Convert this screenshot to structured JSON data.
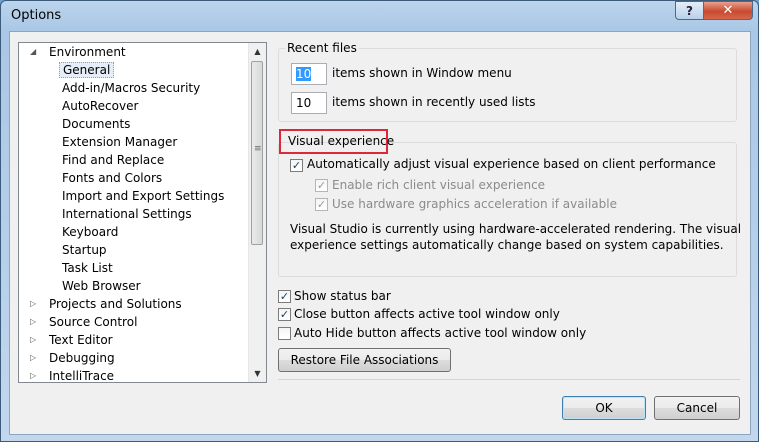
{
  "window": {
    "title": "Options",
    "help_label": "?",
    "close_label": "✕"
  },
  "tree": {
    "items": [
      {
        "label": "Environment",
        "expanded": true,
        "level": 0
      },
      {
        "label": "General",
        "level": 1,
        "selected": true
      },
      {
        "label": "Add-in/Macros Security",
        "level": 1
      },
      {
        "label": "AutoRecover",
        "level": 1
      },
      {
        "label": "Documents",
        "level": 1
      },
      {
        "label": "Extension Manager",
        "level": 1
      },
      {
        "label": "Find and Replace",
        "level": 1
      },
      {
        "label": "Fonts and Colors",
        "level": 1
      },
      {
        "label": "Import and Export Settings",
        "level": 1
      },
      {
        "label": "International Settings",
        "level": 1
      },
      {
        "label": "Keyboard",
        "level": 1
      },
      {
        "label": "Startup",
        "level": 1
      },
      {
        "label": "Task List",
        "level": 1
      },
      {
        "label": "Web Browser",
        "level": 1
      },
      {
        "label": "Projects and Solutions",
        "level": 0
      },
      {
        "label": "Source Control",
        "level": 0
      },
      {
        "label": "Text Editor",
        "level": 0
      },
      {
        "label": "Debugging",
        "level": 0
      },
      {
        "label": "IntelliTrace",
        "level": 0
      }
    ]
  },
  "recent_files": {
    "title": "Recent files",
    "window_menu_count": "10",
    "window_menu_label": "items shown in Window menu",
    "recent_lists_count": "10",
    "recent_lists_label": "items shown in recently used lists"
  },
  "visual_experience": {
    "title": "Visual experience",
    "auto_adjust_label": "Automatically adjust visual experience based on client performance",
    "auto_adjust_checked": true,
    "rich_visual_label": "Enable rich client visual experience",
    "rich_visual_checked": true,
    "hw_accel_label": "Use hardware graphics acceleration if available",
    "hw_accel_checked": true,
    "info_line1": "Visual Studio is currently using hardware-accelerated rendering. The visual",
    "info_line2": "experience settings automatically change based on system capabilities."
  },
  "options": {
    "status_bar_label": "Show status bar",
    "status_bar_checked": true,
    "close_button_label": "Close button affects active tool window only",
    "close_button_checked": true,
    "auto_hide_label": "Auto Hide button affects active tool window only",
    "auto_hide_checked": false,
    "restore_label": "Restore File Associations"
  },
  "buttons": {
    "ok": "OK",
    "cancel": "Cancel"
  },
  "colors": {
    "highlight": "#e0263a",
    "selection": "#3399ff"
  }
}
